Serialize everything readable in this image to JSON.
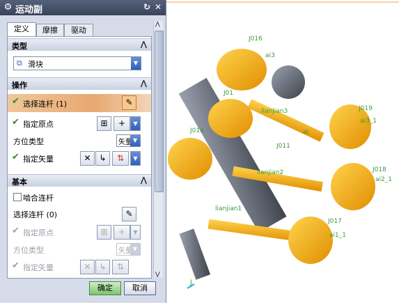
{
  "dialog": {
    "title": "运动副",
    "icon": "gear-icon",
    "title_buttons": [
      "reset-icon",
      "close-icon"
    ],
    "tabs": [
      {
        "label": "定义",
        "active": true
      },
      {
        "label": "摩擦",
        "active": false
      },
      {
        "label": "驱动",
        "active": false
      }
    ],
    "type_section": {
      "title": "类型",
      "value": "滑块"
    },
    "operation_section": {
      "title": "操作",
      "select_link": "选择连杆 (1)",
      "specify_origin": "指定原点",
      "orientation_type_label": "方位类型",
      "orientation_type_value": "矢量",
      "specify_vector": "指定矢量"
    },
    "base_section": {
      "title": "基本",
      "engage_link": "啮合连杆",
      "select_link": "选择连杆 (0)",
      "specify_origin": "指定原点",
      "orientation_type_label": "方位类型",
      "orientation_type_value": "矢量",
      "specify_vector": "指定矢量"
    },
    "buttons": {
      "ok": "确定",
      "cancel": "取消"
    }
  },
  "viewport": {
    "labels": [
      "J016",
      "ai3",
      "J01",
      "lianjian3",
      "J019",
      "ai3_1",
      "J014",
      "ai",
      "J011",
      "J018",
      "lianjian2",
      "ai2_1",
      "lianjian1",
      "J017",
      "ai1_1",
      "J"
    ]
  },
  "colors": {
    "accent": "#f5a623",
    "link_label": "#3a9a3a",
    "title_bar": "#47526a"
  }
}
